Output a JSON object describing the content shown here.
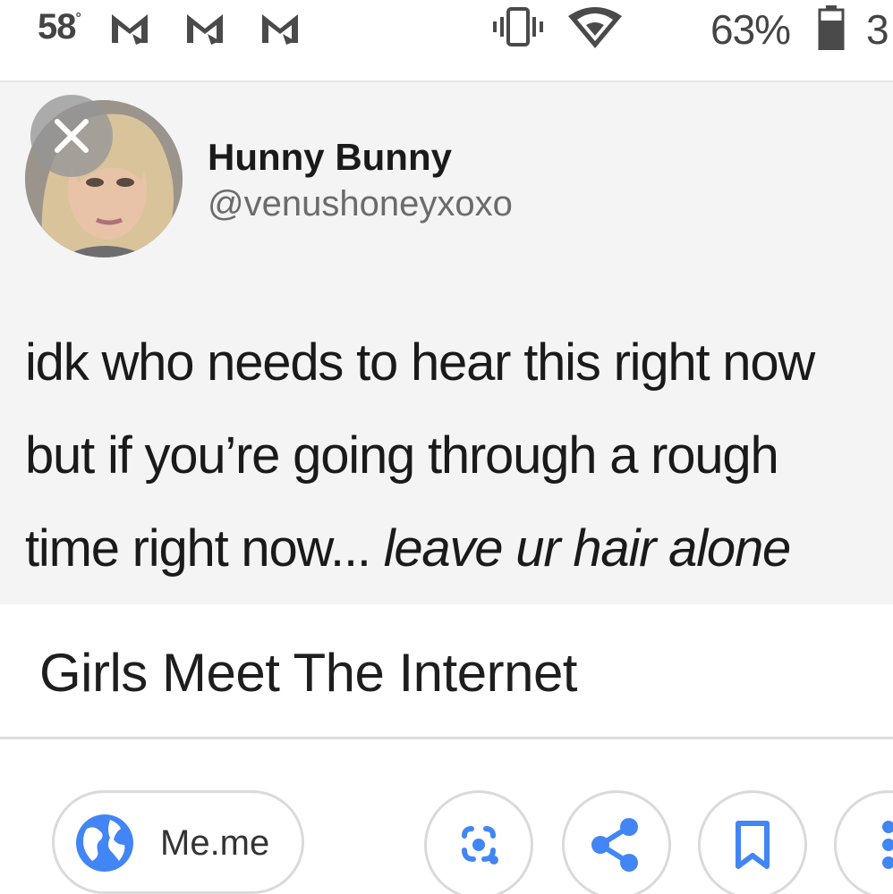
{
  "status_bar": {
    "temperature": "58",
    "temperature_unit": "°",
    "notification_icons": [
      "gmail-icon",
      "gmail-icon",
      "gmail-icon"
    ],
    "vibrate_icon": "vibrate-icon",
    "wifi_icon": "wifi-icon",
    "battery_percent": "63%",
    "battery_icon": "battery-icon",
    "clock_partial": "3"
  },
  "tweet": {
    "display_name": "Hunny Bunny",
    "handle": "@venushoneyxoxo",
    "lines": [
      "idk who needs to hear this right now",
      "but if you’re going through a rough",
      "time right now... "
    ],
    "emphasis": "leave ur hair alone",
    "avatar_overlay_icon": "close-icon"
  },
  "caption": "Girls Meet The Internet",
  "actions": {
    "source_label": "Me.me",
    "source_icon": "globe-icon",
    "buttons": [
      "lens-icon",
      "share-icon",
      "bookmark-icon",
      "more-vertical-icon"
    ]
  },
  "colors": {
    "accent_blue": "#4285f4",
    "card_background": "#f4f4f4",
    "text_primary": "#1a1a1a",
    "text_secondary": "#6b6b6b",
    "chip_border": "#dadada"
  }
}
